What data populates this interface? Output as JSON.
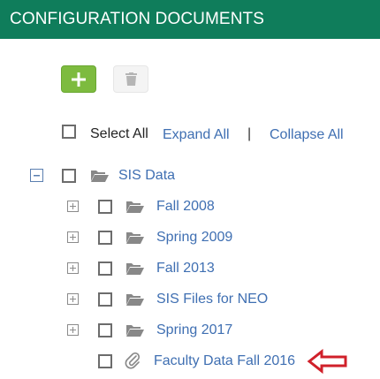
{
  "header": {
    "title": "CONFIGURATION DOCUMENTS"
  },
  "toolbar": {
    "add_icon": "plus-icon",
    "delete_icon": "trash-icon"
  },
  "selection": {
    "select_all": "Select All",
    "expand_all": "Expand All",
    "separator": "|",
    "collapse_all": "Collapse All"
  },
  "tree": {
    "root": {
      "label": "SIS Data",
      "expanded": true,
      "icon": "folder-open-icon"
    },
    "children": [
      {
        "label": "Fall 2008",
        "type": "folder"
      },
      {
        "label": "Spring 2009",
        "type": "folder"
      },
      {
        "label": "Fall 2013",
        "type": "folder"
      },
      {
        "label": "SIS Files for NEO",
        "type": "folder"
      },
      {
        "label": "Spring 2017",
        "type": "folder"
      },
      {
        "label": "Faculty Data Fall 2016",
        "type": "file"
      }
    ]
  },
  "colors": {
    "header_bg": "#0f7d5b",
    "add_button": "#7dbb3f",
    "link": "#3f6fb2",
    "annotation_arrow": "#d0202a"
  }
}
